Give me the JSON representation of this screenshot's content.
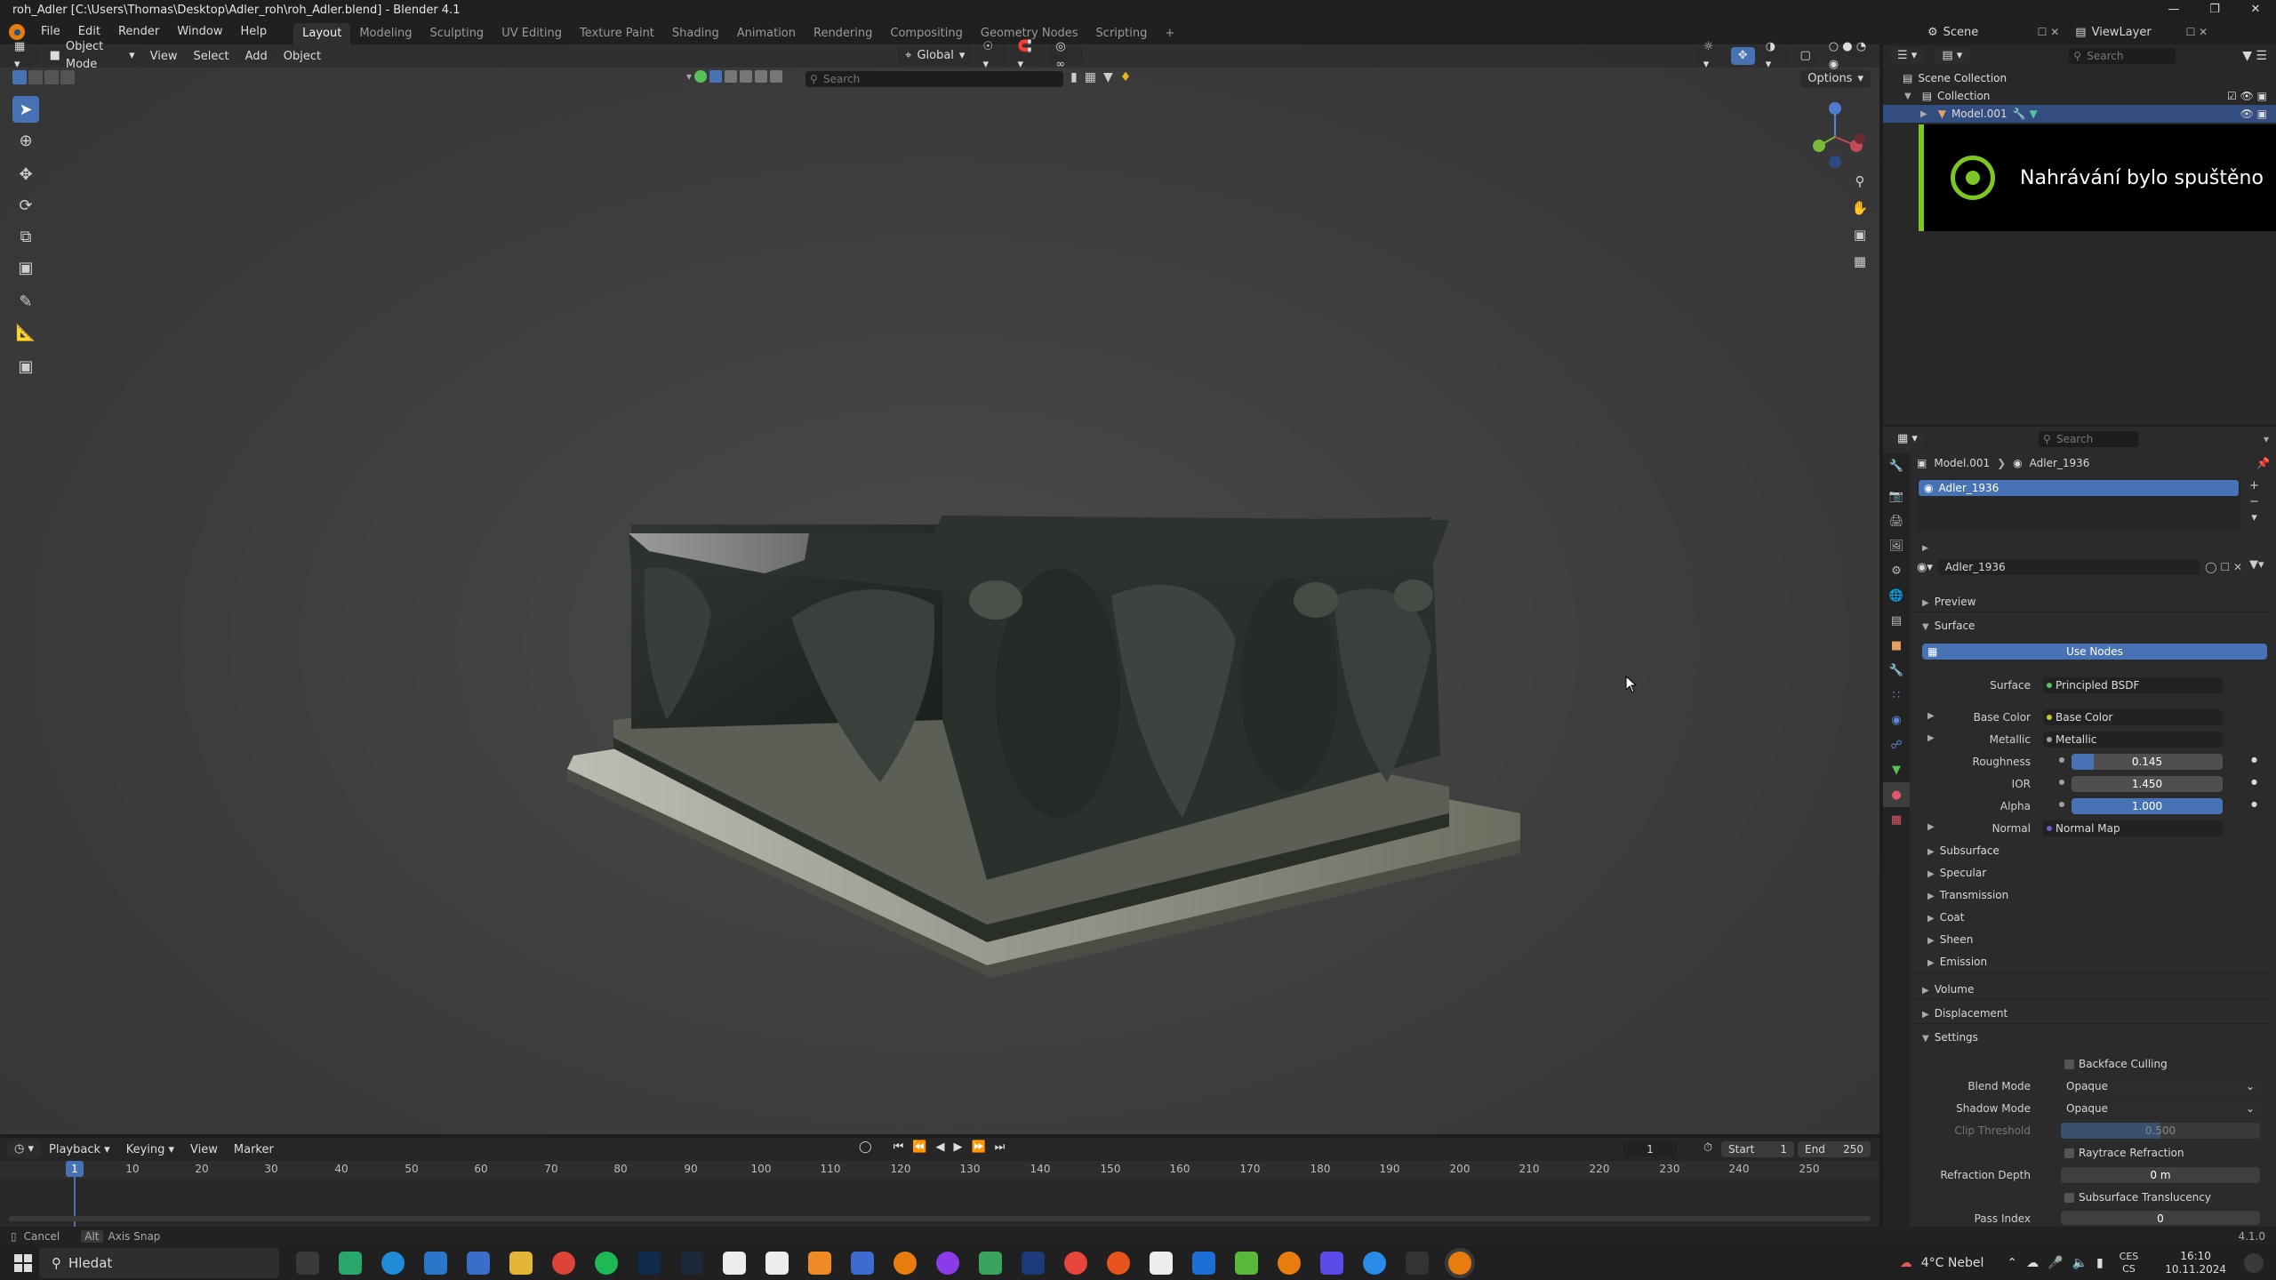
{
  "window": {
    "title": "roh_Adler [C:\\Users\\Thomas\\Desktop\\Adler_roh\\roh_Adler.blend] - Blender 4.1"
  },
  "menu": [
    "File",
    "Edit",
    "Render",
    "Window",
    "Help"
  ],
  "workspaces": [
    "Layout",
    "Modeling",
    "Sculpting",
    "UV Editing",
    "Texture Paint",
    "Shading",
    "Animation",
    "Rendering",
    "Compositing",
    "Geometry Nodes",
    "Scripting"
  ],
  "viewport": {
    "mode": "Object Mode",
    "menus": [
      "View",
      "Select",
      "Add",
      "Object"
    ],
    "transform_orientation": "Global",
    "search_placeholder": "Search",
    "options_label": "Options"
  },
  "scene": {
    "scene_name": "Scene",
    "view_layer": "ViewLayer",
    "search_placeholder": "Search"
  },
  "outliner": {
    "scene_collection": "Scene Collection",
    "collection": "Collection",
    "object": "Model.001"
  },
  "notification": {
    "message": "Nahrávání bylo spuštěno"
  },
  "properties": {
    "search_placeholder": "Search",
    "breadcrumb_object": "Model.001",
    "breadcrumb_material": "Adler_1936",
    "material_slot": "Adler_1936",
    "material_name": "Adler_1936",
    "panels": {
      "preview": "Preview",
      "surface": "Surface",
      "volume": "Volume",
      "displacement": "Displacement",
      "settings": "Settings"
    },
    "use_nodes": "Use Nodes",
    "surface_label": "Surface",
    "surface_value": "Principled BSDF",
    "base_color_label": "Base Color",
    "base_color_value": "Base Color",
    "metallic_label": "Metallic",
    "metallic_value": "Metallic",
    "roughness_label": "Roughness",
    "roughness_value": "0.145",
    "ior_label": "IOR",
    "ior_value": "1.450",
    "alpha_label": "Alpha",
    "alpha_value": "1.000",
    "normal_label": "Normal",
    "normal_value": "Normal Map",
    "subpanels": [
      "Subsurface",
      "Specular",
      "Transmission",
      "Coat",
      "Sheen",
      "Emission"
    ],
    "settings": {
      "backface_culling": "Backface Culling",
      "blend_mode_label": "Blend Mode",
      "blend_mode": "Opaque",
      "shadow_mode_label": "Shadow Mode",
      "shadow_mode": "Opaque",
      "clip_threshold_label": "Clip Threshold",
      "clip_threshold": "0.500",
      "raytrace_refraction": "Raytrace Refraction",
      "refraction_depth_label": "Refraction Depth",
      "refraction_depth": "0 m",
      "subsurface_translucency": "Subsurface Translucency",
      "pass_index_label": "Pass Index",
      "pass_index": "0"
    }
  },
  "timeline": {
    "menus": [
      "Playback",
      "Keying",
      "View",
      "Marker"
    ],
    "current_frame": "1",
    "start_label": "Start",
    "start": "1",
    "end_label": "End",
    "end": "250",
    "ticks": [
      "1",
      "10",
      "20",
      "30",
      "40",
      "50",
      "60",
      "70",
      "80",
      "90",
      "100",
      "110",
      "120",
      "130",
      "140",
      "150",
      "160",
      "170",
      "180",
      "190",
      "200",
      "210",
      "220",
      "230",
      "240",
      "250"
    ]
  },
  "status": {
    "cancel": "Cancel",
    "alt_key": "Alt",
    "axis_snap": "Axis Snap",
    "version": "4.1.0"
  },
  "taskbar": {
    "search_placeholder": "Hledat",
    "weather": "4°C  Nebel",
    "lang_top": "CES",
    "lang_bottom": "CS",
    "time": "16:10",
    "date": "10.11.2024"
  }
}
